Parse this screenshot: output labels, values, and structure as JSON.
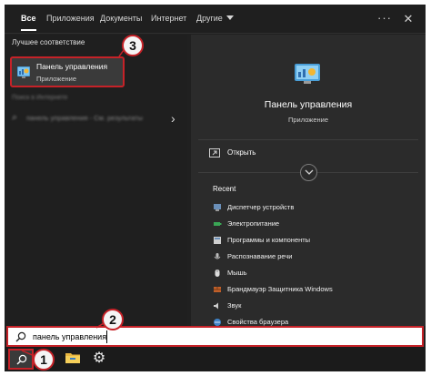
{
  "tabs": [
    {
      "label": "Все"
    },
    {
      "label": "Приложения"
    },
    {
      "label": "Документы"
    },
    {
      "label": "Интернет"
    },
    {
      "label": "Другие"
    }
  ],
  "best_match": {
    "section_title": "Лучшее соответствие",
    "name": "Панель управления",
    "type": "Приложение",
    "icon": "control-panel-icon"
  },
  "web_search": {
    "section_title": "Поиск в Интернете",
    "text": "панель управления - См. результаты"
  },
  "details": {
    "title": "Панель управления",
    "type": "Приложение",
    "open_label": "Открыть",
    "recent_title": "Recent",
    "recent": [
      {
        "label": "Диспетчер устройств",
        "icon": "device-manager-icon"
      },
      {
        "label": "Электропитание",
        "icon": "power-icon"
      },
      {
        "label": "Программы и компоненты",
        "icon": "programs-icon"
      },
      {
        "label": "Распознавание речи",
        "icon": "microphone-icon"
      },
      {
        "label": "Мышь",
        "icon": "mouse-icon"
      },
      {
        "label": "Брандмауэр Защитника Windows",
        "icon": "firewall-icon"
      },
      {
        "label": "Звук",
        "icon": "sound-icon"
      },
      {
        "label": "Свойства браузера",
        "icon": "browser-properties-icon"
      }
    ]
  },
  "search": {
    "value": "панель управления"
  },
  "steps": {
    "one": "1",
    "two": "2",
    "three": "3"
  },
  "colors": {
    "highlight": "#c62228",
    "background": "#202020",
    "details_background": "#2b2b2b"
  }
}
